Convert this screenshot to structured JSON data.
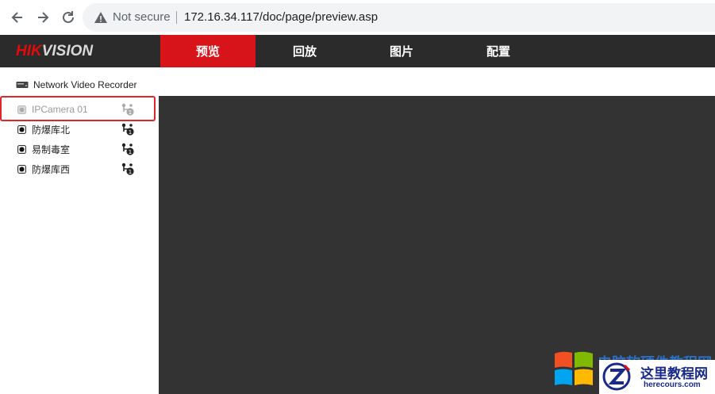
{
  "browser": {
    "security_label": "Not secure",
    "url": "172.16.34.117/doc/page/preview.asp"
  },
  "header": {
    "logo_hik": "HIK",
    "logo_vision": "VISION",
    "tabs": [
      {
        "label": "预览",
        "active": true
      },
      {
        "label": "回放",
        "active": false
      },
      {
        "label": "图片",
        "active": false
      },
      {
        "label": "配置",
        "active": false
      }
    ]
  },
  "sidebar": {
    "device": "Network Video Recorder",
    "cameras": [
      {
        "label": "IPCamera 01",
        "online": false
      },
      {
        "label": "防爆库北",
        "online": true
      },
      {
        "label": "易制毒室",
        "online": true
      },
      {
        "label": "防爆库西",
        "online": true
      }
    ]
  },
  "watermark": {
    "top_text": "电脑软硬件教程网",
    "site_cn": "这里教程网",
    "site_url": "herecours.com"
  },
  "colors": {
    "accent": "#d7141a",
    "header_bg": "#2b2b2b",
    "video_bg": "#333333",
    "highlight": "#e0252b"
  }
}
